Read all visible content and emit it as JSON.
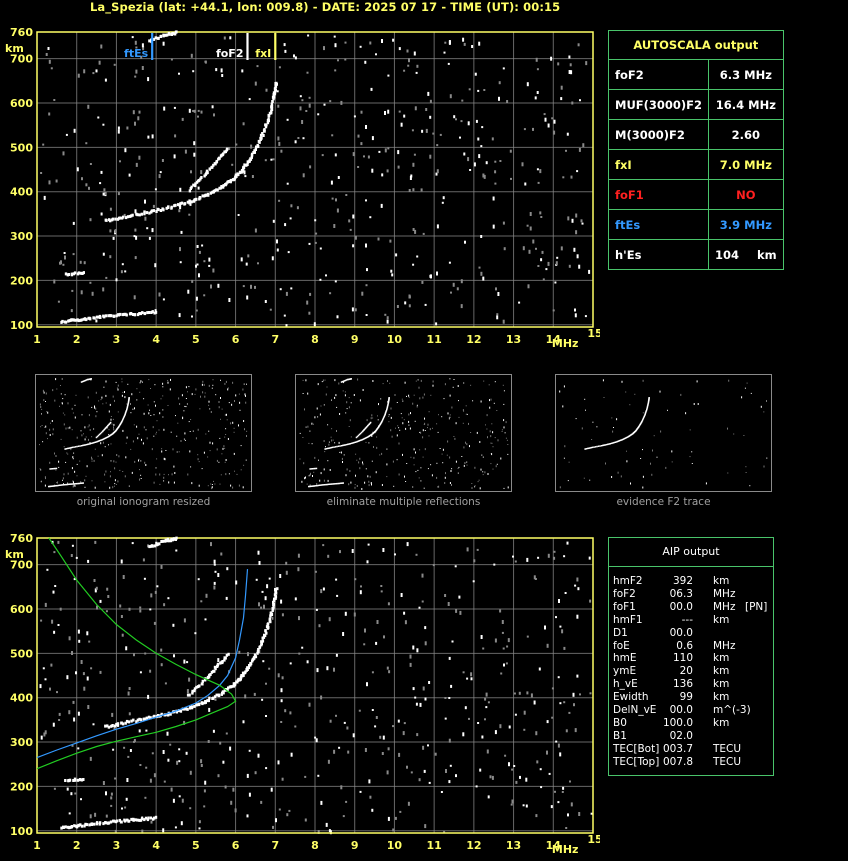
{
  "title": "La_Spezia (lat: +44.1, lon: 009.8) - DATE: 2025 07 17 - TIME (UT): 00:15",
  "colors": {
    "axis": "#ffff66",
    "grid": "#8a8a8a",
    "border": "#49c46a",
    "blue": "#3399ff",
    "red": "#ff2020",
    "green": "#22cc22",
    "yellow": "#ffff66"
  },
  "autoscala": {
    "title": "AUTOSCALA output",
    "rows": [
      {
        "label": "foF2",
        "value": "6.3 MHz",
        "color": "#ffffff"
      },
      {
        "label": "MUF(3000)F2",
        "value": "16.4 MHz",
        "color": "#ffffff"
      },
      {
        "label": "M(3000)F2",
        "value": "2.60",
        "color": "#ffffff"
      },
      {
        "label": "fxI",
        "value": "7.0 MHz",
        "color": "#ffff66"
      },
      {
        "label": "foF1",
        "value": "NO",
        "color": "#ff2020"
      },
      {
        "label": "ftEs",
        "value": "3.9 MHz",
        "color": "#3399ff"
      },
      {
        "label": "h'Es",
        "value": "104",
        "unit": "km",
        "color": "#ffffff"
      }
    ]
  },
  "aip": {
    "title": "AIP output",
    "rows": [
      {
        "name": "hmF2",
        "value": "392",
        "unit": "km",
        "extra": ""
      },
      {
        "name": "foF2",
        "value": "06.3",
        "unit": "MHz",
        "extra": ""
      },
      {
        "name": "foF1",
        "value": "00.0",
        "unit": "MHz",
        "extra": "[PN]"
      },
      {
        "name": "hmF1",
        "value": "---",
        "unit": "km",
        "extra": ""
      },
      {
        "name": "D1",
        "value": "00.0",
        "unit": "",
        "extra": ""
      },
      {
        "name": "foE",
        "value": "0.6",
        "unit": "MHz",
        "extra": ""
      },
      {
        "name": "hmE",
        "value": "110",
        "unit": "km",
        "extra": ""
      },
      {
        "name": "ymE",
        "value": "20",
        "unit": "km",
        "extra": ""
      },
      {
        "name": "h_vE",
        "value": "136",
        "unit": "km",
        "extra": ""
      },
      {
        "name": "Ewidth",
        "value": "99",
        "unit": "km",
        "extra": ""
      },
      {
        "name": "DelN_vE",
        "value": "00.0",
        "unit": "m^(-3)",
        "extra": ""
      },
      {
        "name": "B0",
        "value": "100.0",
        "unit": "km",
        "extra": ""
      },
      {
        "name": "B1",
        "value": "02.0",
        "unit": "",
        "extra": ""
      },
      {
        "name": "TEC[Bot]",
        "value": "003.7",
        "unit": "TECU",
        "extra": ""
      },
      {
        "name": "TEC[Top]",
        "value": "007.8",
        "unit": "TECU",
        "extra": ""
      }
    ]
  },
  "thumbnails": [
    {
      "caption": "original ionogram resized"
    },
    {
      "caption": "eliminate multiple reflections"
    },
    {
      "caption": "evidence F2 trace"
    }
  ],
  "chart_data": [
    {
      "type": "scatter",
      "title": "",
      "xlabel": "MHz",
      "ylabel": "km",
      "xlim": [
        1,
        15
      ],
      "ylim": [
        95,
        760
      ],
      "x_ticks": [
        1,
        2,
        3,
        4,
        5,
        6,
        7,
        8,
        9,
        10,
        11,
        12,
        13,
        14,
        15
      ],
      "y_ticks": [
        100,
        200,
        300,
        400,
        500,
        600,
        700,
        760
      ],
      "grid": true,
      "markers": [
        {
          "label": "ftEs",
          "x": 3.9,
          "color": "#3399ff"
        },
        {
          "label": "foF2",
          "x": 6.3,
          "color": "#ffffff"
        },
        {
          "label": "fxI",
          "x": 7.0,
          "color": "#ffff66"
        }
      ],
      "series": [
        {
          "points": [
            [
              2.7,
              335
            ],
            [
              3.2,
              345
            ],
            [
              3.8,
              355
            ],
            [
              4.3,
              365
            ],
            [
              4.8,
              378
            ],
            [
              5.2,
              392
            ],
            [
              5.6,
              410
            ],
            [
              5.9,
              428
            ],
            [
              6.1,
              445
            ],
            [
              6.3,
              470
            ],
            [
              6.5,
              500
            ],
            [
              6.7,
              540
            ],
            [
              6.85,
              580
            ],
            [
              6.95,
              620
            ],
            [
              7.0,
              650
            ]
          ]
        },
        {
          "points": [
            [
              1.6,
              108
            ],
            [
              2.0,
              112
            ],
            [
              2.5,
              118
            ],
            [
              3.0,
              122
            ],
            [
              3.5,
              126
            ],
            [
              4.0,
              130
            ]
          ]
        },
        {
          "points": [
            [
              3.8,
              740
            ],
            [
              4.2,
              755
            ],
            [
              4.5,
              760
            ]
          ]
        },
        {
          "points": [
            [
              1.7,
              215
            ],
            [
              2.2,
              218
            ]
          ]
        },
        {
          "points": [
            [
              4.8,
              405
            ],
            [
              5.2,
              440
            ],
            [
              5.5,
              470
            ],
            [
              5.8,
              500
            ]
          ]
        }
      ]
    },
    {
      "type": "line",
      "title": "",
      "xlabel": "MHz",
      "ylabel": "km",
      "xlim": [
        1,
        15
      ],
      "ylim": [
        95,
        760
      ],
      "x_ticks": [
        1,
        2,
        3,
        4,
        5,
        6,
        7,
        8,
        9,
        10,
        11,
        12,
        13,
        14,
        15
      ],
      "y_ticks": [
        100,
        200,
        300,
        400,
        500,
        600,
        700,
        760
      ],
      "grid": true,
      "series": [
        {
          "color": "#3399ff",
          "points": [
            [
              1.0,
              265
            ],
            [
              1.5,
              282
            ],
            [
              2.0,
              298
            ],
            [
              2.5,
              314
            ],
            [
              3.0,
              329
            ],
            [
              3.5,
              342
            ],
            [
              4.0,
              356
            ],
            [
              4.5,
              370
            ],
            [
              5.0,
              388
            ],
            [
              5.3,
              405
            ],
            [
              5.6,
              428
            ],
            [
              5.8,
              450
            ],
            [
              6.0,
              490
            ],
            [
              6.1,
              530
            ],
            [
              6.2,
              580
            ],
            [
              6.25,
              630
            ],
            [
              6.3,
              690
            ]
          ]
        },
        {
          "color": "#22cc22",
          "points": [
            [
              1.0,
              240
            ],
            [
              1.5,
              258
            ],
            [
              2.0,
              275
            ],
            [
              2.5,
              290
            ],
            [
              3.0,
              302
            ],
            [
              3.5,
              312
            ],
            [
              4.0,
              322
            ],
            [
              4.5,
              335
            ],
            [
              5.0,
              350
            ],
            [
              5.4,
              365
            ],
            [
              5.8,
              380
            ],
            [
              6.0,
              392
            ],
            [
              5.9,
              408
            ],
            [
              5.6,
              428
            ],
            [
              5.0,
              452
            ],
            [
              4.5,
              475
            ],
            [
              4.0,
              500
            ],
            [
              3.5,
              530
            ],
            [
              3.0,
              565
            ],
            [
              2.5,
              610
            ],
            [
              2.0,
              665
            ],
            [
              1.6,
              720
            ],
            [
              1.3,
              760
            ]
          ]
        }
      ]
    }
  ]
}
